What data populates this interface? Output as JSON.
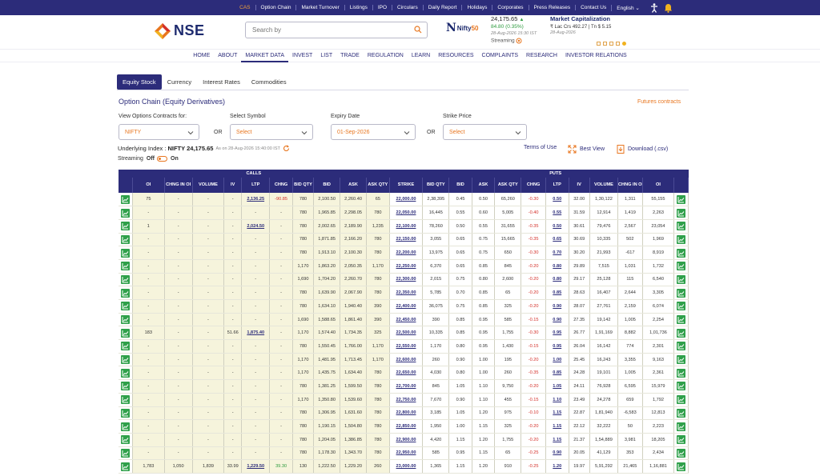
{
  "topbar": {
    "items": [
      "CAS",
      "Option Chain",
      "Market Turnover",
      "Listings",
      "IPO",
      "Circulars",
      "Daily Report",
      "Holidays",
      "Corporates",
      "Press Releases",
      "Contact Us"
    ],
    "language": "English"
  },
  "header": {
    "logo_text": "NSE",
    "search_placeholder": "Search by",
    "nifty_label_a": "Nifty",
    "nifty_label_b": "50",
    "index_value": "24,175.65",
    "index_change": "84.80 (0.35%)",
    "index_time": "28-Aug-2026 15:30 IST",
    "streaming_label": "Streaming",
    "mcap_title": "Market Capitalization",
    "mcap_value": "₹ Lac Crs 492.27 | Tn $ 5.15",
    "mcap_date": "28-Aug-2026"
  },
  "mainnav": [
    "HOME",
    "ABOUT",
    "MARKET DATA",
    "INVEST",
    "LIST",
    "TRADE",
    "REGULATION",
    "LEARN",
    "RESOURCES",
    "COMPLAINTS",
    "RESEARCH",
    "INVESTOR RELATIONS"
  ],
  "subtabs": [
    "Equity Stock",
    "Currency",
    "Interest Rates",
    "Commodities"
  ],
  "page": {
    "title": "Option Chain (Equity Derivatives)",
    "futures_link": "Futures contracts",
    "view_label": "View Options Contracts for:",
    "view_value": "NIFTY",
    "or1": "OR",
    "symbol_label": "Select Symbol",
    "symbol_value": "Select",
    "expiry_label": "Expiry Date",
    "expiry_value": "01-Sep-2026",
    "or2": "OR",
    "strike_label": "Strike Price",
    "strike_value": "Select",
    "underlying_prefix": "Underlying Index :",
    "underlying_value": "NIFTY 24,175.65",
    "underlying_time": "As on 28-Aug-2026 15:40:00 IST",
    "terms": "Terms of Use",
    "best_view": "Best View",
    "download": "Download (.csv)",
    "streaming": "Streaming",
    "stream_off": "Off",
    "stream_on": "On"
  },
  "table": {
    "calls_label": "CALLS",
    "puts_label": "PUTS",
    "headers": [
      "",
      "OI",
      "CHNG IN OI",
      "VOLUME",
      "IV",
      "LTP",
      "CHNG",
      "BID QTY",
      "BID",
      "ASK",
      "ASK QTY",
      "STRIKE",
      "BID QTY",
      "BID",
      "ASK",
      "ASK QTY",
      "CHNG",
      "LTP",
      "IV",
      "VOLUME",
      "CHNG IN OI",
      "OI",
      ""
    ],
    "rows": [
      [
        "75",
        "-",
        "-",
        "-",
        "2,136.25",
        "-90.85",
        "780",
        "2,100.50",
        "2,260.40",
        "65",
        "22,000.00",
        "2,38,395",
        "0.45",
        "0.50",
        "65,260",
        "-0.30",
        "0.50",
        "32.00",
        "1,30,122",
        "1,311",
        "55,155"
      ],
      [
        "-",
        "-",
        "-",
        "-",
        "-",
        "-",
        "780",
        "1,965.85",
        "2,298.05",
        "780",
        "22,050.00",
        "16,445",
        "0.55",
        "0.60",
        "5,005",
        "-0.40",
        "0.55",
        "31.59",
        "12,914",
        "1,419",
        "2,263"
      ],
      [
        "1",
        "-",
        "-",
        "-",
        "2,024.50",
        "-",
        "780",
        "2,002.65",
        "2,189.90",
        "1,235",
        "22,100.00",
        "78,260",
        "0.50",
        "0.55",
        "31,655",
        "-0.35",
        "0.50",
        "30.61",
        "79,476",
        "2,567",
        "23,054"
      ],
      [
        "-",
        "-",
        "-",
        "-",
        "-",
        "-",
        "780",
        "1,871.85",
        "2,166.20",
        "780",
        "22,150.00",
        "3,055",
        "0.65",
        "0.75",
        "15,665",
        "-0.35",
        "0.65",
        "30.69",
        "10,335",
        "502",
        "1,969"
      ],
      [
        "-",
        "-",
        "-",
        "-",
        "-",
        "-",
        "780",
        "1,913.10",
        "2,100.30",
        "780",
        "22,200.00",
        "13,975",
        "0.65",
        "0.75",
        "650",
        "-0.30",
        "0.70",
        "30.20",
        "21,993",
        "-617",
        "8,919"
      ],
      [
        "-",
        "-",
        "-",
        "-",
        "-",
        "-",
        "1,170",
        "1,863.20",
        "2,050.35",
        "1,170",
        "22,250.00",
        "6,370",
        "0.65",
        "0.85",
        "845",
        "-0.20",
        "0.80",
        "29.89",
        "7,515",
        "1,031",
        "1,732"
      ],
      [
        "-",
        "-",
        "-",
        "-",
        "-",
        "-",
        "1,690",
        "1,704.20",
        "2,260.70",
        "780",
        "22,300.00",
        "2,015",
        "0.75",
        "0.80",
        "2,600",
        "-0.20",
        "0.80",
        "29.17",
        "25,128",
        "115",
        "6,540"
      ],
      [
        "-",
        "-",
        "-",
        "-",
        "-",
        "-",
        "780",
        "1,639.90",
        "2,067.90",
        "780",
        "22,350.00",
        "5,785",
        "0.70",
        "0.85",
        "65",
        "-0.20",
        "0.85",
        "28.63",
        "16,407",
        "2,644",
        "3,305"
      ],
      [
        "-",
        "-",
        "-",
        "-",
        "-",
        "-",
        "780",
        "1,634.10",
        "1,940.40",
        "390",
        "22,400.00",
        "36,075",
        "0.75",
        "0.85",
        "325",
        "-0.20",
        "0.90",
        "28.07",
        "27,761",
        "2,159",
        "6,074"
      ],
      [
        "-",
        "-",
        "-",
        "-",
        "-",
        "-",
        "1,690",
        "1,588.65",
        "1,861.40",
        "390",
        "22,450.00",
        "390",
        "0.85",
        "0.95",
        "585",
        "-0.15",
        "0.90",
        "27.35",
        "19,142",
        "1,005",
        "2,254"
      ],
      [
        "183",
        "-",
        "-",
        "51.66",
        "1,875.40",
        "-",
        "1,170",
        "1,574.40",
        "1,734.35",
        "325",
        "22,500.00",
        "10,335",
        "0.85",
        "0.95",
        "1,755",
        "-0.30",
        "0.95",
        "26.77",
        "1,91,169",
        "8,882",
        "1,01,736"
      ],
      [
        "-",
        "-",
        "-",
        "-",
        "-",
        "-",
        "780",
        "1,550.45",
        "1,766.00",
        "1,170",
        "22,550.00",
        "1,170",
        "0.80",
        "0.95",
        "1,430",
        "-0.15",
        "0.95",
        "26.04",
        "16,142",
        "774",
        "2,301"
      ],
      [
        "-",
        "-",
        "-",
        "-",
        "-",
        "-",
        "1,170",
        "1,481.95",
        "1,713.45",
        "1,170",
        "22,600.00",
        "260",
        "0.90",
        "1.00",
        "195",
        "-0.20",
        "1.00",
        "25.45",
        "16,243",
        "3,355",
        "9,163"
      ],
      [
        "-",
        "-",
        "-",
        "-",
        "-",
        "-",
        "1,170",
        "1,435.75",
        "1,634.40",
        "780",
        "22,650.00",
        "4,030",
        "0.80",
        "1.00",
        "260",
        "-0.35",
        "0.85",
        "24.28",
        "19,101",
        "1,005",
        "2,361"
      ],
      [
        "-",
        "-",
        "-",
        "-",
        "-",
        "-",
        "780",
        "1,381.25",
        "1,599.50",
        "780",
        "22,700.00",
        "845",
        "1.05",
        "1.10",
        "9,750",
        "-0.20",
        "1.05",
        "24.11",
        "76,928",
        "6,595",
        "15,979"
      ],
      [
        "-",
        "-",
        "-",
        "-",
        "-",
        "-",
        "1,170",
        "1,350.80",
        "1,539.60",
        "780",
        "22,750.00",
        "7,670",
        "0.90",
        "1.10",
        "455",
        "-0.15",
        "1.10",
        "23.49",
        "24,278",
        "659",
        "1,792"
      ],
      [
        "-",
        "-",
        "-",
        "-",
        "-",
        "-",
        "780",
        "1,306.95",
        "1,631.60",
        "780",
        "22,800.00",
        "3,185",
        "1.05",
        "1.20",
        "975",
        "-0.10",
        "1.15",
        "22.87",
        "1,81,940",
        "-6,583",
        "12,813"
      ],
      [
        "-",
        "-",
        "-",
        "-",
        "-",
        "-",
        "780",
        "1,190.15",
        "1,504.80",
        "780",
        "22,850.00",
        "1,950",
        "1.00",
        "1.15",
        "325",
        "-0.20",
        "1.15",
        "22.12",
        "32,222",
        "50",
        "2,223"
      ],
      [
        "-",
        "-",
        "-",
        "-",
        "-",
        "-",
        "780",
        "1,204.05",
        "1,386.85",
        "780",
        "22,900.00",
        "4,420",
        "1.15",
        "1.20",
        "1,755",
        "-0.20",
        "1.15",
        "21.37",
        "1,54,889",
        "3,981",
        "18,205"
      ],
      [
        "-",
        "-",
        "-",
        "-",
        "-",
        "-",
        "780",
        "1,178.30",
        "1,343.70",
        "780",
        "22,950.00",
        "585",
        "0.95",
        "1.15",
        "65",
        "-0.25",
        "0.90",
        "20.05",
        "41,129",
        "353",
        "2,434"
      ],
      [
        "1,783",
        "1,050",
        "1,839",
        "33.99",
        "1,229.50",
        "39.30",
        "130",
        "1,222.50",
        "1,229.20",
        "260",
        "23,000.00",
        "1,365",
        "1.15",
        "1.20",
        "910",
        "-0.25",
        "1.20",
        "19.97",
        "5,91,292",
        "21,465",
        "1,16,881"
      ]
    ]
  }
}
